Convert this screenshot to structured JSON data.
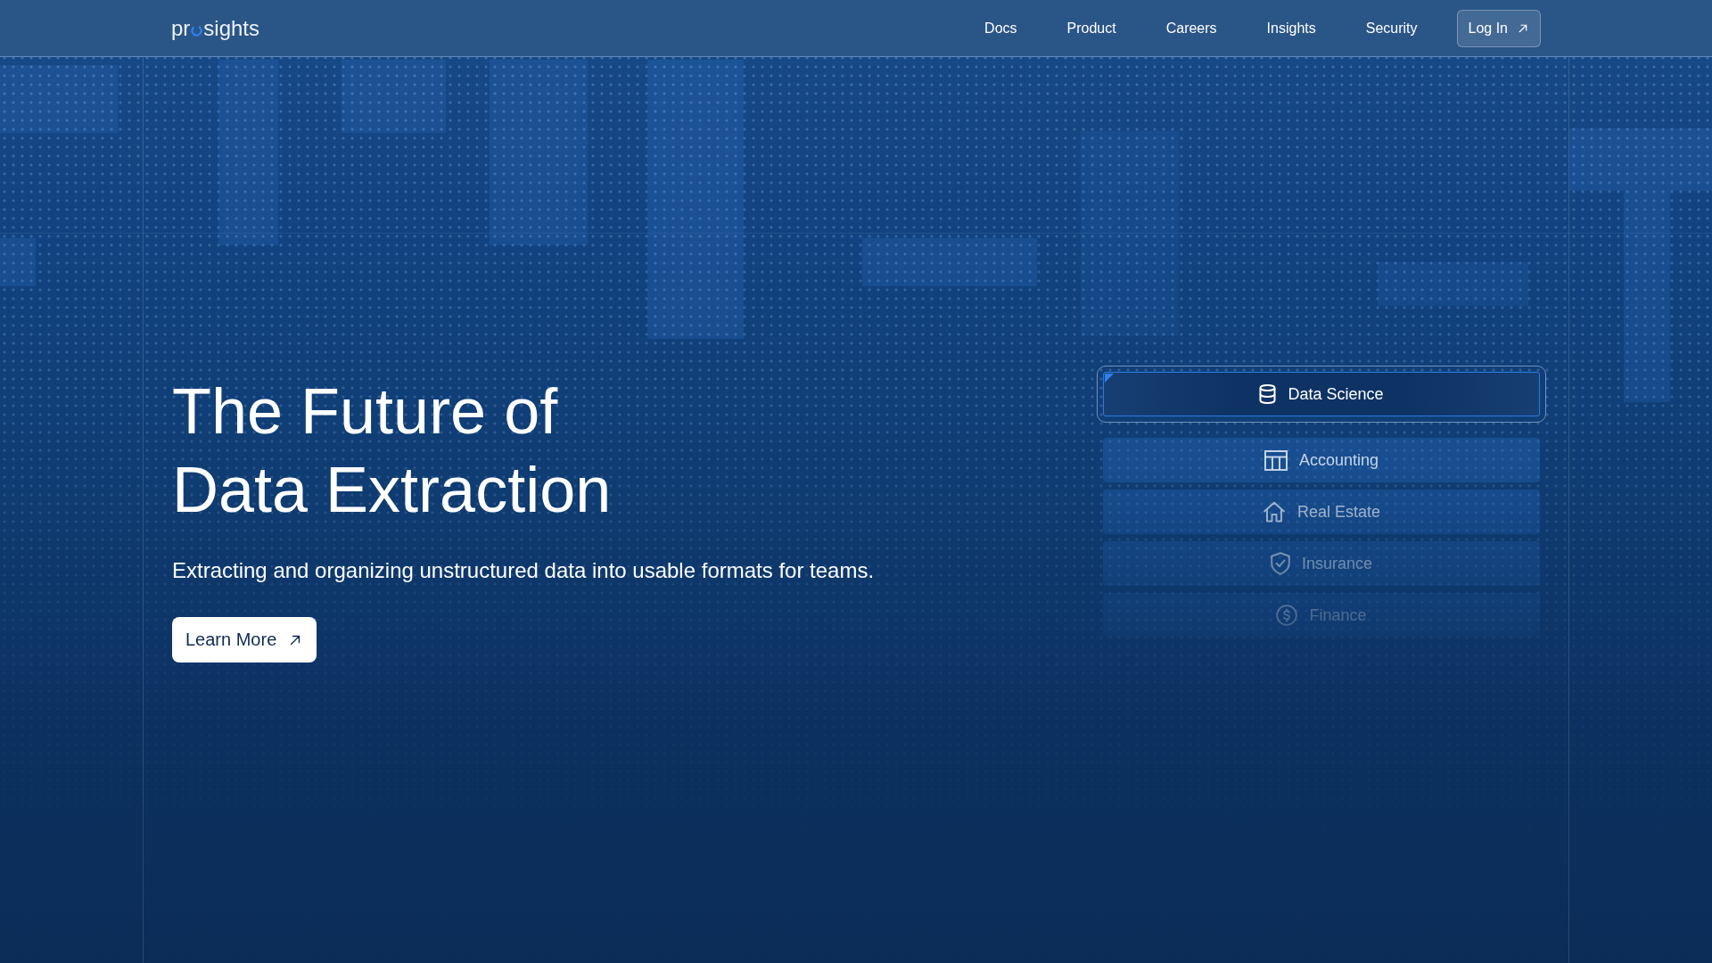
{
  "logo": {
    "lead": "pr",
    "tail": "sights"
  },
  "nav": {
    "links": [
      "Docs",
      "Product",
      "Careers",
      "Insights",
      "Security"
    ],
    "login": {
      "label": "Log In"
    }
  },
  "hero": {
    "title": "The Future of Data Extraction",
    "subtitle": "Extracting and organizing unstructured data into usable formats for teams.",
    "cta": {
      "label": "Learn More"
    }
  },
  "industries": [
    {
      "label": "Data Science",
      "kind": "database",
      "selected": true
    },
    {
      "label": "Accounting",
      "kind": "table",
      "selected": false
    },
    {
      "label": "Real Estate",
      "kind": "house",
      "selected": false
    },
    {
      "label": "Insurance",
      "kind": "shield",
      "selected": false
    },
    {
      "label": "Finance",
      "kind": "dollar",
      "selected": false
    }
  ]
}
